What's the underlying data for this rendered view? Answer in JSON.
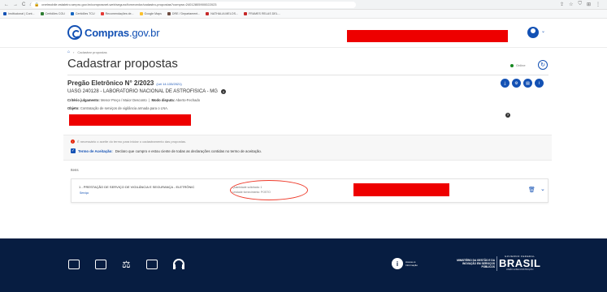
{
  "browser": {
    "url": "cnetmobile.estaleiro.serpro.gov.br/comprasnet-web/seguro/fornecedor/cadastro-propostas?compra=24012805900022023",
    "nav_icons": [
      "←",
      "→",
      "C",
      "⌂"
    ],
    "right_icons": [
      "⇪",
      "☆",
      "⛉",
      "⊞",
      "⋮"
    ]
  },
  "bookmarks": [
    {
      "label": "Institucional | Cont...",
      "color": "#1351b4"
    },
    {
      "label": "Certidões CGU",
      "color": "#2e7d32"
    },
    {
      "label": "Certidões TCU",
      "color": "#1565c0"
    },
    {
      "label": "Recomendações de...",
      "color": "#e53935"
    },
    {
      "label": "Google Maps",
      "color": "#fbc02d"
    },
    {
      "label": "DRE / Departament...",
      "color": "#6d4c41"
    },
    {
      "label": "NATHALIA MELOS...",
      "color": "#c62828"
    },
    {
      "label": "FRAMES RELAS DEL...",
      "color": "#c62828"
    }
  ],
  "header": {
    "logo_text": "Compras",
    "logo_suffix": ".gov.br"
  },
  "breadcrumb": {
    "home_icon": "home-icon",
    "label": "Cadastrar propostas"
  },
  "page": {
    "title": "Cadastrar propostas",
    "status": "Online",
    "pregao": "Pregão Eletrônico N° 2/2023",
    "lei": "(Lei 14.133/2021)",
    "uasg": "UASG 240128 - LABORATORIO NACIONAL DE ASTROFISICA - MG",
    "criterio_label": "Critério julgamento:",
    "criterio_value": "Menor Preço / Maior Desconto",
    "modo_label": "Modo disputa:",
    "modo_value": "Aberto-Fechado",
    "objeto_label": "Objeto:",
    "objeto_value": "Contratação de serviços de vigilância armada para o LNA."
  },
  "notice": {
    "warning": "É necessário o aceite do termo para iniciar o cadastramento das propostas.",
    "accept_link": "Termo de Aceitação:",
    "accept_text": "Declaro que cumpro e estou ciente de todas as declarações contidas no termo de aceitação."
  },
  "itens": {
    "label": "Itens",
    "rows": [
      {
        "title": "1 - PRESTAÇÃO DE SERVIÇO DE VIGILÂNCIA E SEGURANÇA - ELETRÔNIC",
        "sub": "Serviço",
        "qty_line1": "Quantidade solicitada: 1",
        "qty_line2": "Unidade fornecimento: POSTO"
      }
    ]
  },
  "footer": {
    "acesso": "Acesso à Informação",
    "ministerio": "MINISTÉRIO DA GESTÃO E DA INOVAÇÃO EM SERVIÇOS PÚBLICOS",
    "gov_federal": "GOVERNO FEDERAL",
    "brasil": "BRASIL",
    "slogan": "UNIÃO E RECONSTRUÇÃO"
  }
}
